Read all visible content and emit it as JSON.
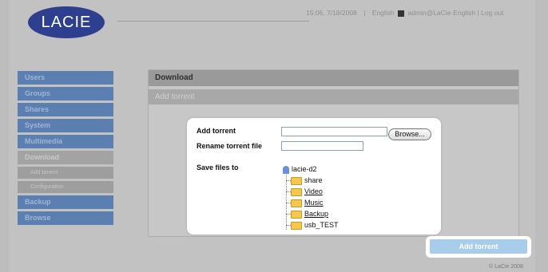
{
  "header": {
    "logo_text": "LACIE",
    "time_date": "15:06, 7/18/2008",
    "separator": "|",
    "language": "English",
    "user_logout": "admin@LaCie-English | Log out"
  },
  "sidebar": {
    "items": [
      {
        "label": "Users"
      },
      {
        "label": "Groups"
      },
      {
        "label": "Shares"
      },
      {
        "label": "System"
      },
      {
        "label": "Multimedia"
      },
      {
        "label": "Download"
      },
      {
        "label": "Add torrent"
      },
      {
        "label": "Configuration"
      },
      {
        "label": "Backup"
      },
      {
        "label": "Browse"
      }
    ]
  },
  "main": {
    "title": "Download",
    "subtitle": "Add torrent"
  },
  "dialog": {
    "add_torrent_label": "Add torrent",
    "rename_label": "Rename torrent file",
    "save_label": "Save files to",
    "browse_label": "Browse...",
    "torrent_value": "",
    "rename_value": "",
    "tree": {
      "root": "lacie-d2",
      "children": [
        "share",
        "Video",
        "Music",
        "Backup",
        "usb_TEST"
      ]
    }
  },
  "actions": {
    "add_torrent_button": "Add torrent"
  },
  "footer": {
    "copyright": "© LaCie 2008"
  },
  "colors": {
    "sidebar_accent": "#5b7fb0",
    "button_accent": "#a8cdea",
    "logo": "#2e3f8f"
  }
}
